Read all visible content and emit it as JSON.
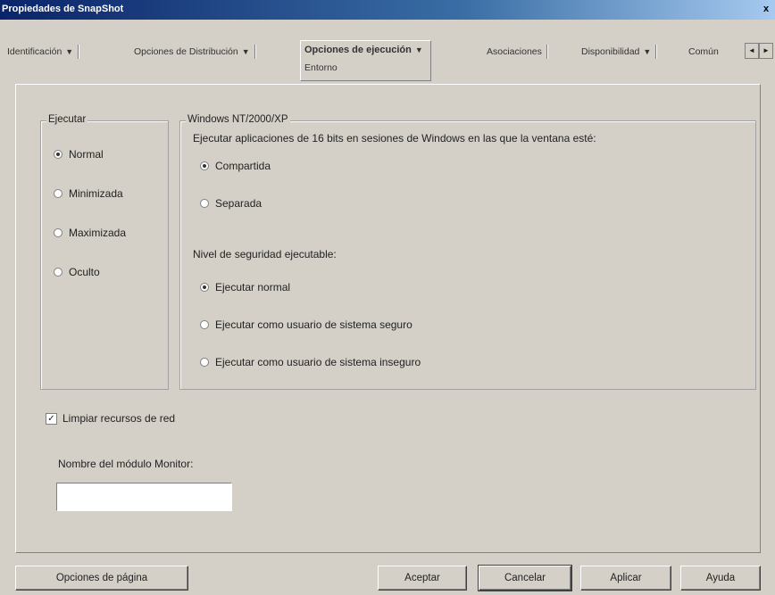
{
  "window": {
    "title": "Propiedades de SnapShot",
    "close": "x"
  },
  "tabs": [
    {
      "label": "Identificación",
      "caret": "▼"
    },
    {
      "label": "Opciones de Distribución",
      "caret": "▼"
    },
    {
      "label": "Opciones de ejecución",
      "caret": "▼",
      "sub": "Entorno"
    },
    {
      "label": "Asociaciones"
    },
    {
      "label": "Disponibilidad",
      "caret": "▼"
    },
    {
      "label": "Común"
    }
  ],
  "tab_scroll": {
    "left": "◄",
    "right": "►"
  },
  "ejecutar": {
    "legend": "Ejecutar",
    "options": [
      "Normal",
      "Minimizada",
      "Maximizada",
      "Oculto"
    ],
    "selected": "Normal"
  },
  "windows": {
    "legend": "Windows NT/2000/XP",
    "question": "Ejecutar aplicaciones de 16 bits en sesiones de Windows en las que la ventana esté:",
    "session_options": [
      "Compartida",
      "Separada"
    ],
    "session_selected": "Compartida",
    "security_label": "Nivel de seguridad ejecutable:",
    "security_options": [
      "Ejecutar normal",
      "Ejecutar como usuario de sistema seguro",
      "Ejecutar como usuario de sistema inseguro"
    ],
    "security_selected": "Ejecutar normal"
  },
  "limpiar": {
    "label": "Limpiar recursos de red",
    "checked": true,
    "mark": "✓"
  },
  "monitor": {
    "label": "Nombre del módulo Monitor:",
    "value": ""
  },
  "buttons": {
    "page_options": "Opciones de página",
    "accept": "Aceptar",
    "cancel": "Cancelar",
    "apply": "Aplicar",
    "help": "Ayuda"
  }
}
